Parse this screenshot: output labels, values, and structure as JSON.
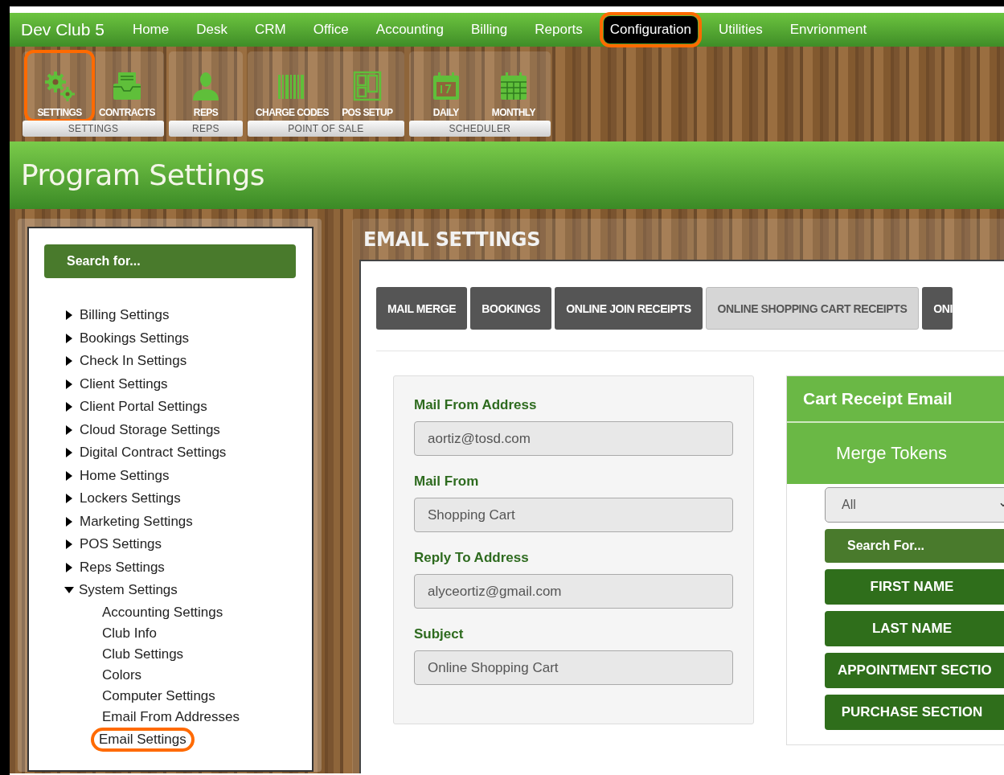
{
  "app": {
    "title": "Dev Club 5"
  },
  "nav": [
    {
      "label": "Home",
      "selected": false,
      "highlighted": false
    },
    {
      "label": "Desk",
      "selected": false,
      "highlighted": false
    },
    {
      "label": "CRM",
      "selected": false,
      "highlighted": false
    },
    {
      "label": "Office",
      "selected": false,
      "highlighted": false
    },
    {
      "label": "Accounting",
      "selected": false,
      "highlighted": false
    },
    {
      "label": "Billing",
      "selected": false,
      "highlighted": false
    },
    {
      "label": "Reports",
      "selected": false,
      "highlighted": false
    },
    {
      "label": "Configuration",
      "selected": true,
      "highlighted": true
    },
    {
      "label": "Utilities",
      "selected": false,
      "highlighted": false
    },
    {
      "label": "Envrionment",
      "selected": false,
      "highlighted": false
    }
  ],
  "toolbar": [
    {
      "label": "SETTINGS",
      "items": [
        {
          "label": "SETTINGS",
          "kind": "gears",
          "highlighted": true
        },
        {
          "label": "CONTRACTS",
          "kind": "tray",
          "highlighted": false
        }
      ]
    },
    {
      "label": "REPS",
      "items": [
        {
          "label": "REPS",
          "kind": "person",
          "highlighted": false
        }
      ]
    },
    {
      "label": "POINT OF SALE",
      "items": [
        {
          "label": "CHARGE CODES",
          "kind": "barcode",
          "highlighted": false
        },
        {
          "label": "POS SETUP",
          "kind": "layout",
          "highlighted": false
        }
      ]
    },
    {
      "label": "SCHEDULER",
      "items": [
        {
          "label": "DAILY",
          "kind": "day",
          "highlighted": false
        },
        {
          "label": "MONTHLY",
          "kind": "month",
          "highlighted": false
        }
      ]
    }
  ],
  "page_title": "Program Settings",
  "sidebar": {
    "search_placeholder": "Search for...",
    "items": [
      {
        "label": "Billing Settings",
        "expanded": false
      },
      {
        "label": "Bookings Settings",
        "expanded": false
      },
      {
        "label": "Check In Settings",
        "expanded": false
      },
      {
        "label": "Client Settings",
        "expanded": false
      },
      {
        "label": "Client Portal Settings",
        "expanded": false
      },
      {
        "label": "Cloud Storage Settings",
        "expanded": false
      },
      {
        "label": "Digital Contract Settings",
        "expanded": false
      },
      {
        "label": "Home Settings",
        "expanded": false
      },
      {
        "label": "Lockers Settings",
        "expanded": false
      },
      {
        "label": "Marketing Settings",
        "expanded": false
      },
      {
        "label": "POS Settings",
        "expanded": false
      },
      {
        "label": "Reps Settings",
        "expanded": false
      },
      {
        "label": "System Settings",
        "expanded": true,
        "children": [
          {
            "label": "Accounting Settings",
            "highlighted": false
          },
          {
            "label": "Club Info",
            "highlighted": false
          },
          {
            "label": "Club Settings",
            "highlighted": false
          },
          {
            "label": "Colors",
            "highlighted": false
          },
          {
            "label": "Computer Settings",
            "highlighted": false
          },
          {
            "label": "Email From Addresses",
            "highlighted": false
          },
          {
            "label": "Email Settings",
            "highlighted": true
          }
        ]
      }
    ]
  },
  "panel": {
    "title": "EMAIL SETTINGS",
    "tabs": [
      {
        "label": "MAIL MERGE",
        "selected": false
      },
      {
        "label": "BOOKINGS",
        "selected": false
      },
      {
        "label": "ONLINE JOIN RECEIPTS",
        "selected": false
      },
      {
        "label": "ONLINE SHOPPING CART RECEIPTS",
        "selected": true
      },
      {
        "label": "ONI",
        "selected": false
      }
    ],
    "fields": [
      {
        "label": "Mail From Address",
        "value": "aortiz@tosd.com"
      },
      {
        "label": "Mail From",
        "value": "Shopping Cart"
      },
      {
        "label": "Reply To Address",
        "value": "alyceortiz@gmail.com"
      },
      {
        "label": "Subject",
        "value": "Online Shopping Cart"
      }
    ],
    "receipt": {
      "title": "Cart Receipt Email",
      "tokens_title": "Merge Tokens",
      "filter": "All",
      "search_placeholder": "Search For...",
      "tokens": [
        "FIRST NAME",
        "LAST NAME",
        "APPOINTMENT SECTIO",
        "PURCHASE SECTION"
      ]
    }
  }
}
